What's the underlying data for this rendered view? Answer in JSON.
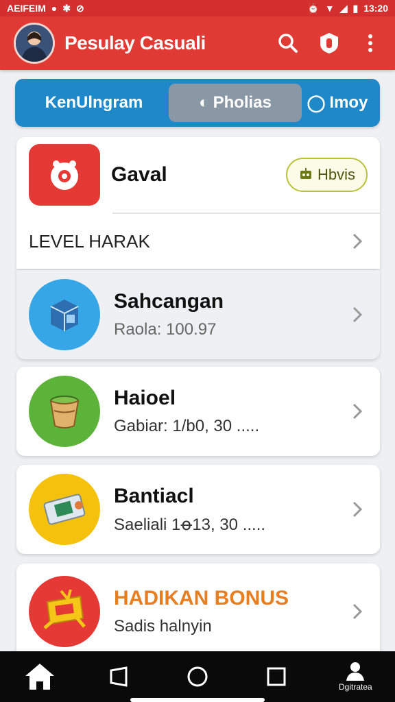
{
  "status_bar": {
    "left_text": "AEIFEIM",
    "time": "13:20"
  },
  "app_bar": {
    "title": "Pesulay Casuali",
    "icons": [
      "search-icon",
      "shield-icon",
      "more-vert-icon"
    ]
  },
  "tabs": [
    {
      "label": "KenUlngram"
    },
    {
      "label": "Pholias",
      "glyph": "◐"
    },
    {
      "label": "Imoy",
      "glyph": "◯"
    }
  ],
  "top_card": {
    "name": "Gaval",
    "pill_label": "Hbvis",
    "level_label": "LEVEL HARAK"
  },
  "items": [
    {
      "title": "Sahcangan",
      "subtitle": "Raola: 100.97",
      "icon": "box-icon",
      "color": "#37a6e6"
    },
    {
      "title": "Haioel",
      "subtitle": "Gabiar: 1⁠/b0, 30 .....",
      "icon": "bucket-icon",
      "color": "#5db33a"
    },
    {
      "title": "Bantiacl",
      "subtitle": "Saeliali 1ꝋ13, 30 .....",
      "icon": "cash-icon",
      "color": "#f4c20d"
    },
    {
      "title": "HADIKAN BONUS",
      "subtitle": "Sadis halnyin",
      "icon": "bonus-icon",
      "color": "#e53935"
    }
  ],
  "nav_bar": {
    "profile_label": "Dgitratea"
  },
  "colors": {
    "app_bar": "#df3a34",
    "tab_bar": "#1e88c9",
    "bonus_title": "#e67e22"
  }
}
